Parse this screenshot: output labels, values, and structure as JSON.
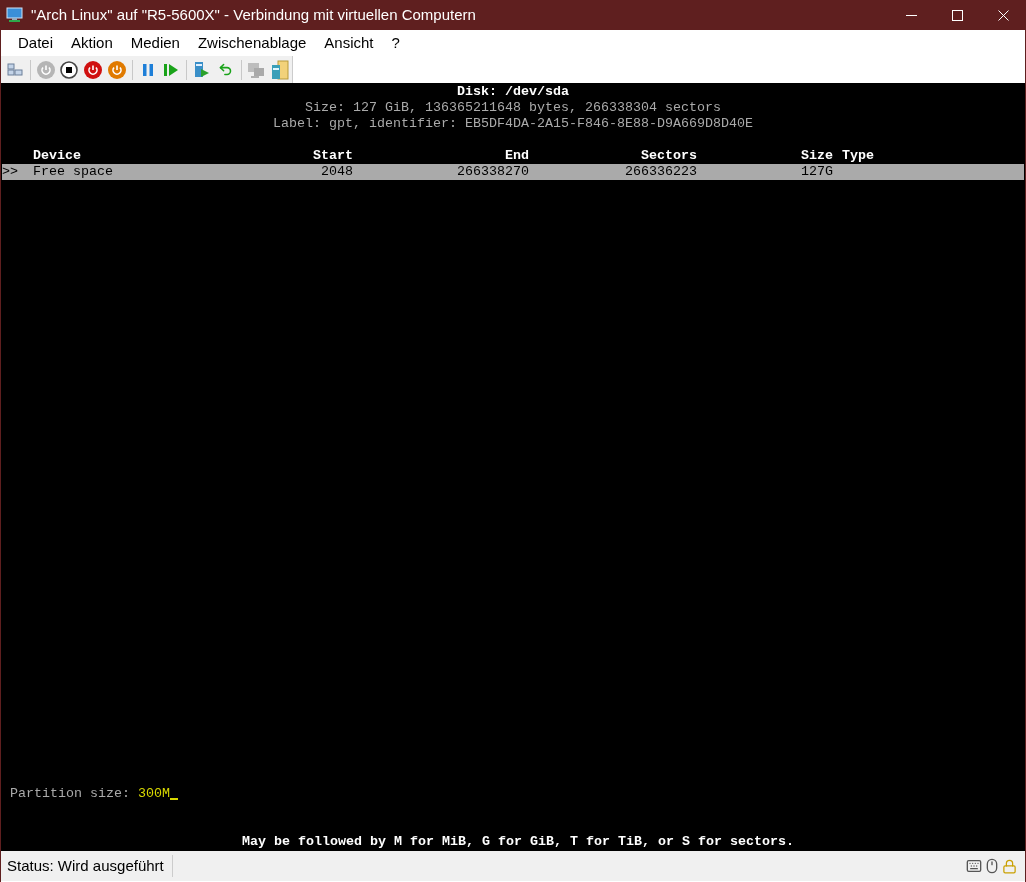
{
  "window": {
    "title": "\"Arch Linux\" auf \"R5-5600X\" - Verbindung mit virtuellen Computern"
  },
  "menu": [
    "Datei",
    "Aktion",
    "Medien",
    "Zwischenablage",
    "Ansicht",
    "?"
  ],
  "toolbar": [
    {
      "kind": "ctrl-alt-del",
      "disabled": false
    },
    {
      "kind": "sep"
    },
    {
      "kind": "start",
      "disabled": true
    },
    {
      "kind": "turn-off",
      "disabled": false
    },
    {
      "kind": "shutdown",
      "disabled": false
    },
    {
      "kind": "save",
      "disabled": false
    },
    {
      "kind": "sep"
    },
    {
      "kind": "pause",
      "disabled": false
    },
    {
      "kind": "resume",
      "disabled": false
    },
    {
      "kind": "sep"
    },
    {
      "kind": "checkpoint",
      "disabled": false
    },
    {
      "kind": "revert",
      "disabled": false
    },
    {
      "kind": "sep"
    },
    {
      "kind": "enhanced",
      "disabled": true
    },
    {
      "kind": "share",
      "disabled": false
    }
  ],
  "terminal": {
    "header": [
      "Disk: /dev/sda",
      "Size: 127 GiB, 136365211648 bytes, 266338304 sectors",
      "Label: gpt, identifier: EB5DF4DA-2A15-F846-8E88-D9A669D8D40E"
    ],
    "columns": [
      "Device",
      "Start",
      "End",
      "Sectors",
      "Size",
      "Type"
    ],
    "rows": [
      {
        "marker": ">>",
        "selected": true,
        "cells": [
          "Free space",
          "2048",
          "266338270",
          "266336223",
          "127G"
        ]
      }
    ],
    "prompt": {
      "label": "Partition size:",
      "value": "300M"
    },
    "hint": "May be followed by M for MiB, G for GiB, T for TiB, or S for sectors."
  },
  "status_bar": {
    "text": "Status: Wird ausgeführt"
  }
}
